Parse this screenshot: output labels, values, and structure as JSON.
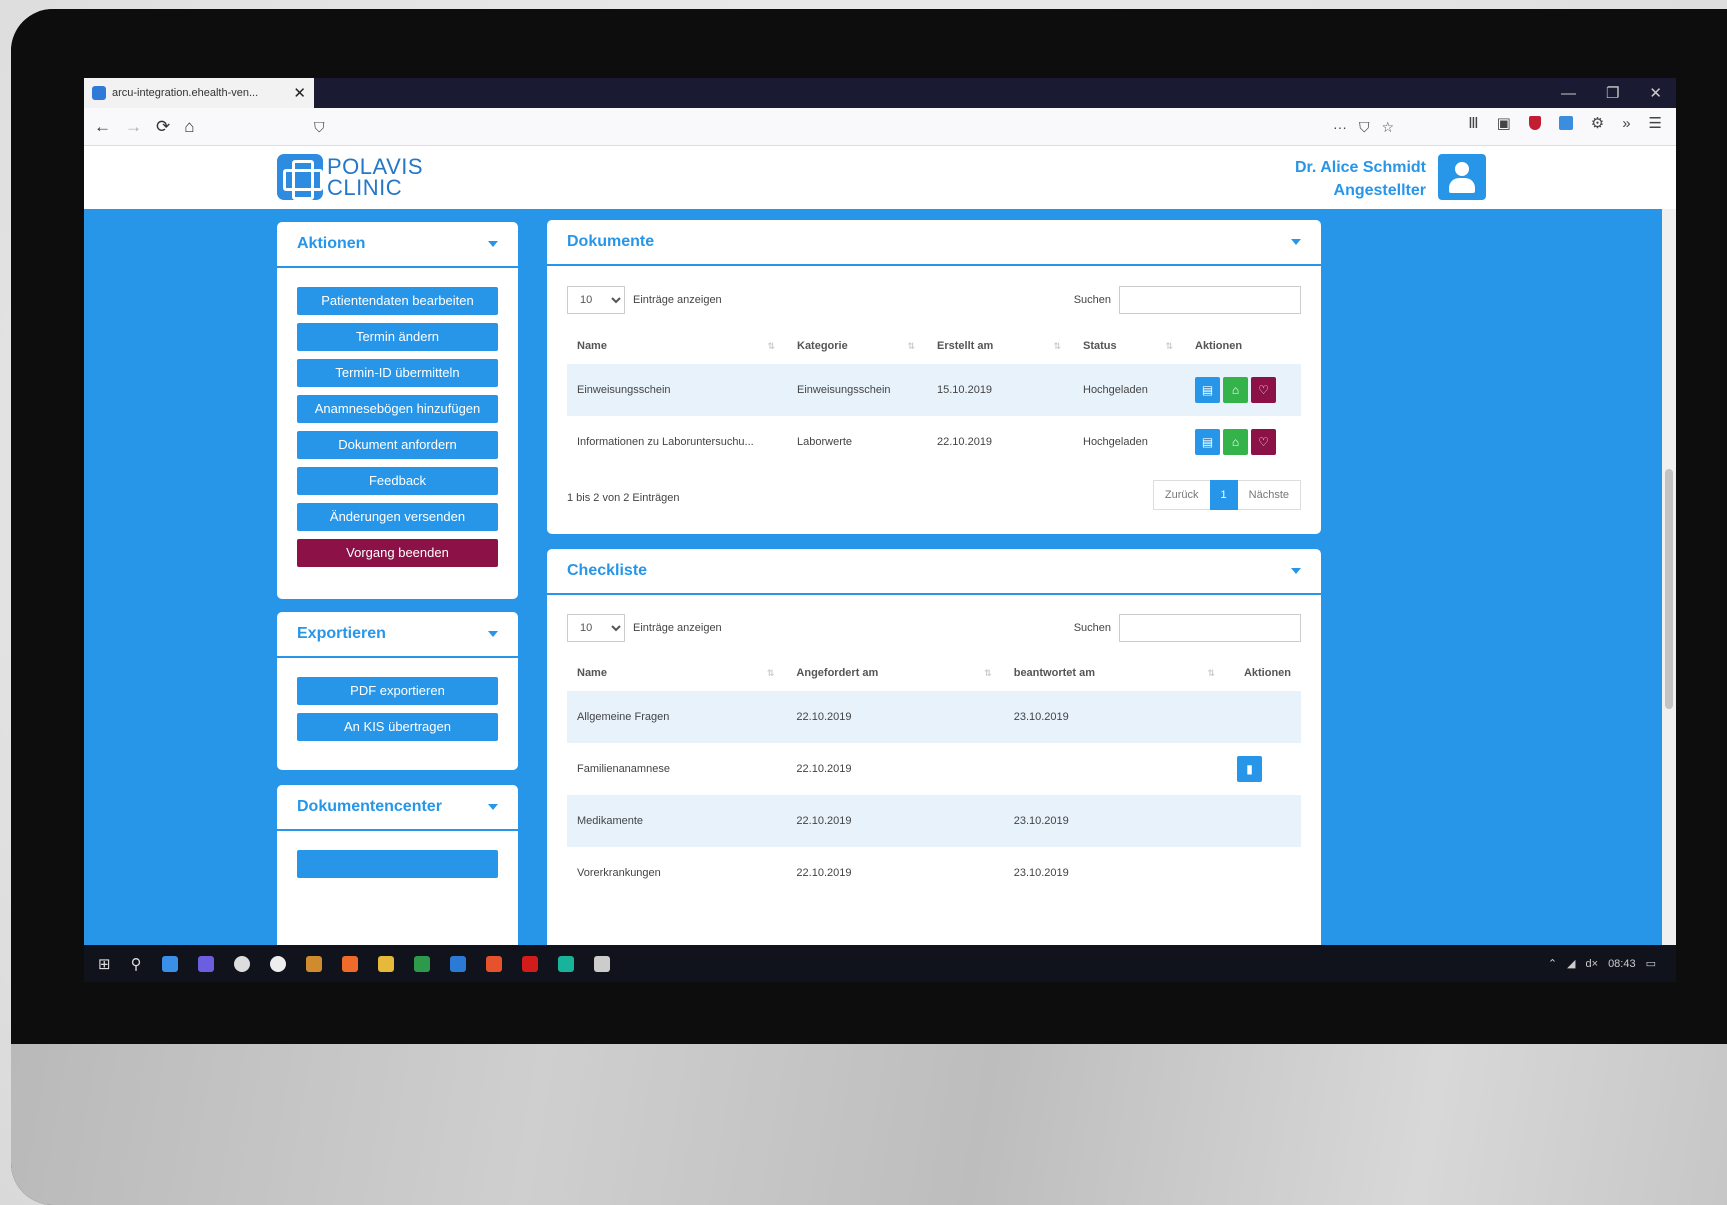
{
  "browser": {
    "tab_title": "arcu-integration.ehealth-ven...",
    "tab_close": "✕",
    "win_controls": [
      "—",
      "❐",
      "✕"
    ],
    "nav_icons": [
      "←",
      "→",
      "⟳",
      "⌂"
    ],
    "url_icons": [
      "···",
      "⛉",
      "☆"
    ],
    "tool_icons": [
      "Ⅲ",
      "▣",
      "⚙",
      "»",
      "☰"
    ]
  },
  "header": {
    "logo_line1": "POLAVIS",
    "logo_line2": "CLINIC",
    "user_name": "Dr. Alice Schmidt",
    "user_role": "Angestellter"
  },
  "aktionen": {
    "title": "Aktionen",
    "buttons": [
      "Patientendaten bearbeiten",
      "Termin ändern",
      "Termin-ID übermitteln",
      "Anamnesebögen hinzufügen",
      "Dokument anfordern",
      "Feedback",
      "Änderungen versenden"
    ],
    "end_button": "Vorgang beenden"
  },
  "exportieren": {
    "title": "Exportieren",
    "buttons": [
      "PDF exportieren",
      "An KIS übertragen"
    ]
  },
  "dokumentencenter": {
    "title": "Dokumentencenter"
  },
  "dokumente": {
    "title": "Dokumente",
    "page_size": "10",
    "entries_label": "Einträge anzeigen",
    "search_label": "Suchen",
    "columns": [
      "Name",
      "Kategorie",
      "Erstellt am",
      "Status",
      "Aktionen"
    ],
    "rows": [
      {
        "name": "Einweisungsschein",
        "kategorie": "Einweisungsschein",
        "erstellt": "15.10.2019",
        "status": "Hochgeladen"
      },
      {
        "name": "Informationen zu Laboruntersuchu...",
        "kategorie": "Laborwerte",
        "erstellt": "22.10.2019",
        "status": "Hochgeladen"
      }
    ],
    "info": "1 bis 2 von 2 Einträgen",
    "prev": "Zurück",
    "page": "1",
    "next": "Nächste"
  },
  "checkliste": {
    "title": "Checkliste",
    "page_size": "10",
    "entries_label": "Einträge anzeigen",
    "search_label": "Suchen",
    "columns": [
      "Name",
      "Angefordert am",
      "beantwortet am",
      "Aktionen"
    ],
    "rows": [
      {
        "name": "Allgemeine Fragen",
        "angefordert": "22.10.2019",
        "beantwortet": "23.10.2019"
      },
      {
        "name": "Familienanamnese",
        "angefordert": "22.10.2019",
        "beantwortet": ""
      },
      {
        "name": "Medikamente",
        "angefordert": "22.10.2019",
        "beantwortet": "23.10.2019"
      },
      {
        "name": "Vorerkrankungen",
        "angefordert": "22.10.2019",
        "beantwortet": "23.10.2019"
      }
    ]
  },
  "taskbar": {
    "time": "08:43",
    "tray_text": "d×"
  }
}
